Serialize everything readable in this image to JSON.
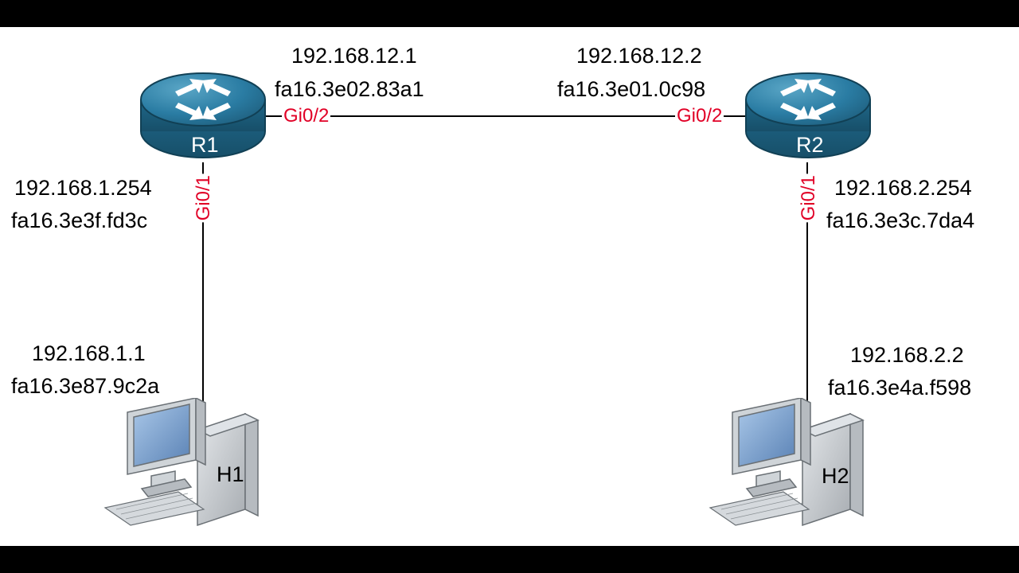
{
  "topology": {
    "routers": {
      "r1": {
        "label": "R1",
        "gi02": {
          "port": "Gi0/2",
          "ip": "192.168.12.1",
          "mac": "fa16.3e02.83a1"
        },
        "gi01": {
          "port": "Gi0/1",
          "ip": "192.168.1.254",
          "mac": "fa16.3e3f.fd3c"
        }
      },
      "r2": {
        "label": "R2",
        "gi02": {
          "port": "Gi0/2",
          "ip": "192.168.12.2",
          "mac": "fa16.3e01.0c98"
        },
        "gi01": {
          "port": "Gi0/1",
          "ip": "192.168.2.254",
          "mac": "fa16.3e3c.7da4"
        }
      }
    },
    "hosts": {
      "h1": {
        "label": "H1",
        "ip": "192.168.1.1",
        "mac": "fa16.3e87.9c2a"
      },
      "h2": {
        "label": "H2",
        "ip": "192.168.2.2",
        "mac": "fa16.3e4a.f598"
      }
    }
  }
}
